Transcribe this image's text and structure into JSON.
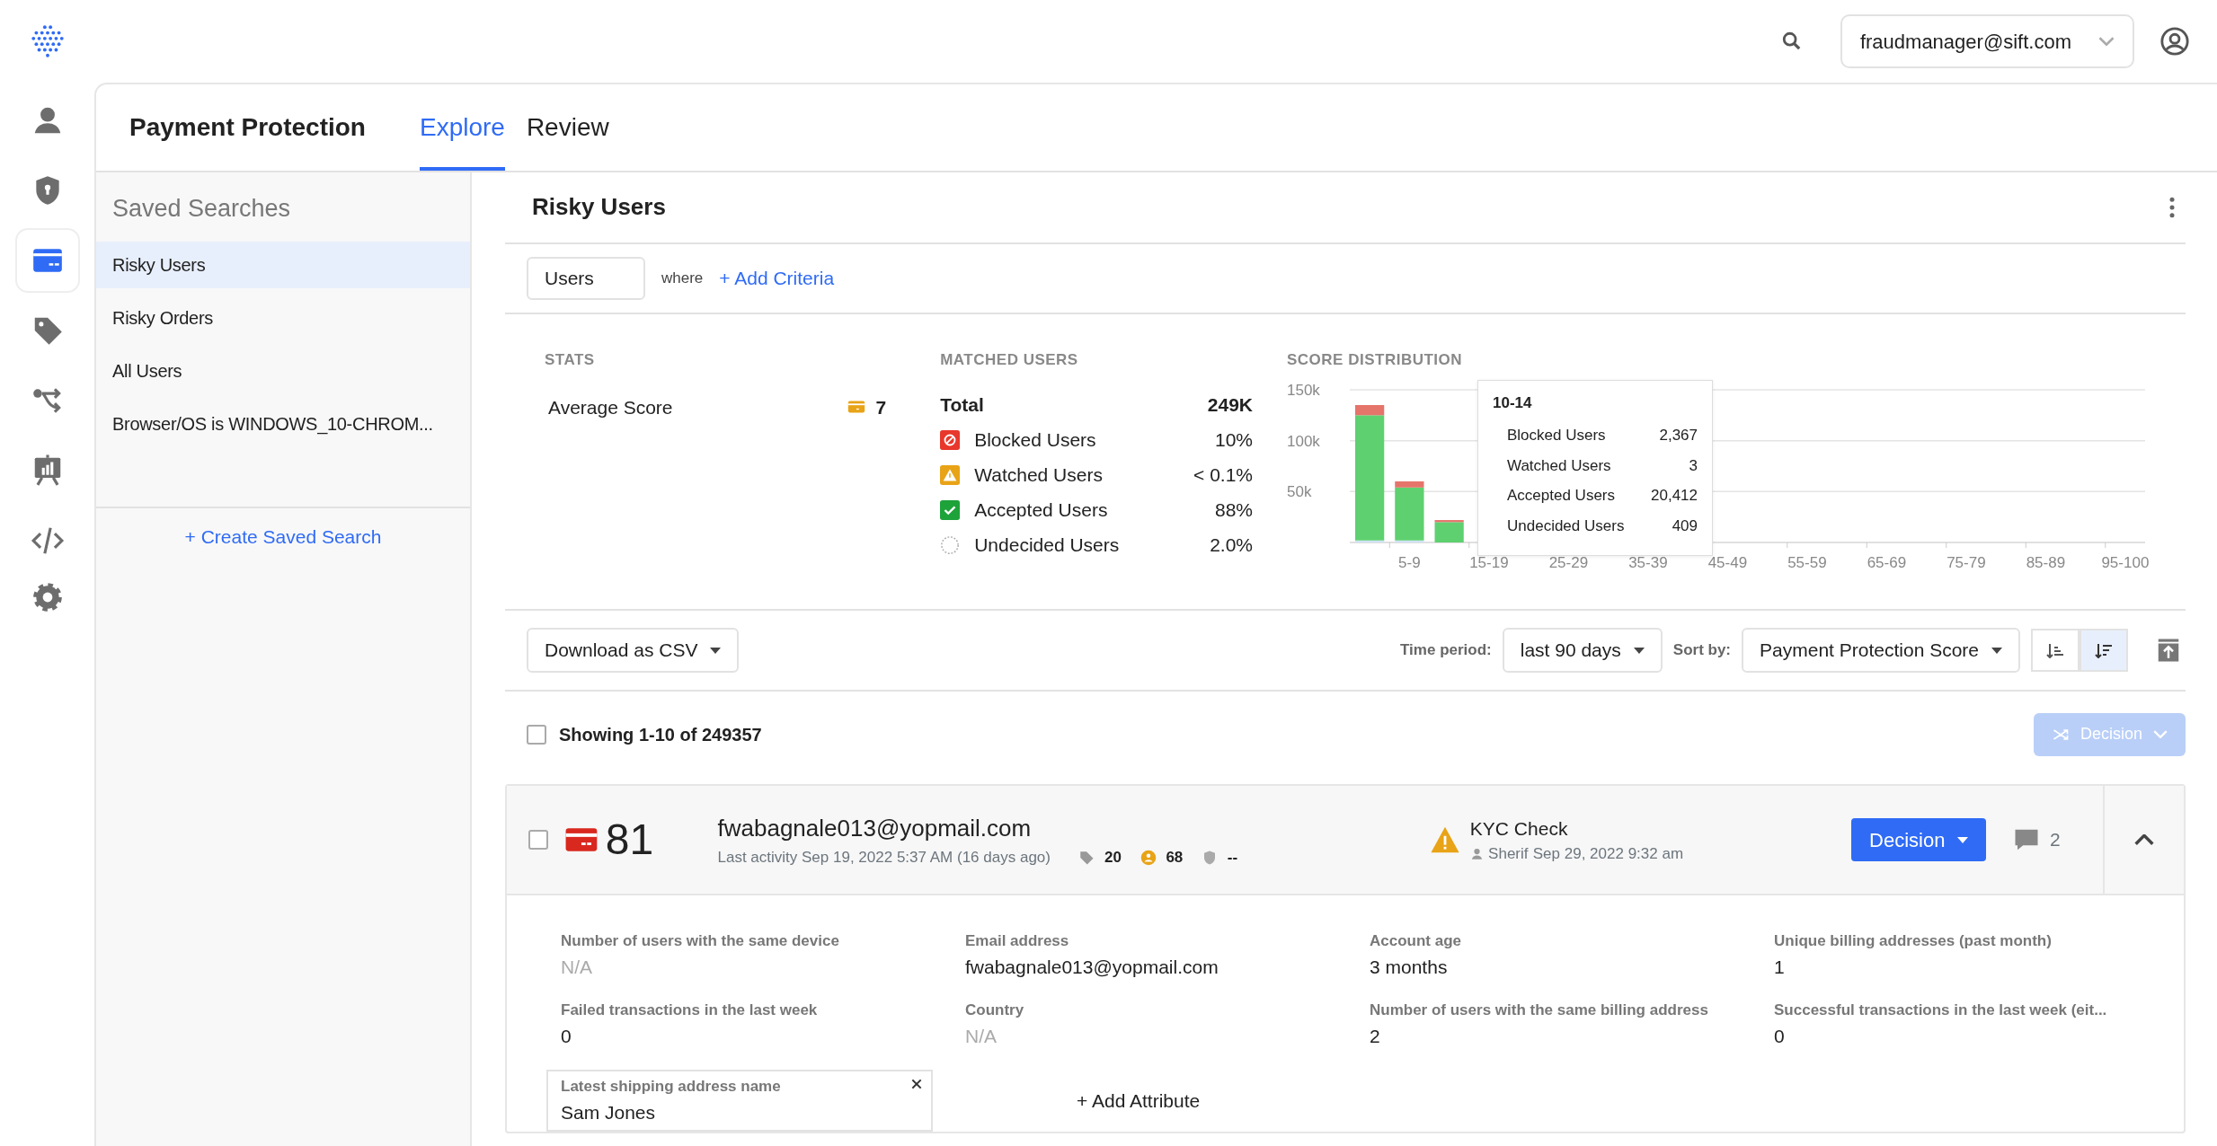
{
  "topbar": {
    "account": "fraudmanager@sift.com"
  },
  "nav_rail": [
    {
      "selected": false
    },
    {
      "selected": false
    },
    {
      "selected": true
    },
    {
      "selected": false
    },
    {
      "selected": false
    },
    {
      "selected": false
    },
    {
      "selected": false
    }
  ],
  "header": {
    "title": "Payment Protection",
    "tabs": [
      {
        "label": "Explore",
        "selected": true
      },
      {
        "label": "Review",
        "selected": false
      }
    ]
  },
  "saved_searches": {
    "title": "Saved Searches",
    "items": [
      {
        "label": "Risky Users",
        "selected": true
      },
      {
        "label": "Risky Orders",
        "selected": false
      },
      {
        "label": "All Users",
        "selected": false
      },
      {
        "label": "Browser/OS is WINDOWS_10-CHROM...",
        "selected": false
      }
    ],
    "create": "+ Create Saved Search"
  },
  "search": {
    "title": "Risky Users",
    "entity": "Users",
    "where": "where",
    "add_criteria": "+ Add Criteria"
  },
  "stats": {
    "heading": "STATS",
    "items": [
      {
        "label": "Average Score",
        "value": "7"
      }
    ]
  },
  "matched": {
    "heading": "MATCHED USERS",
    "total_label": "Total",
    "total": "249K",
    "rows": [
      {
        "kind": "blocked",
        "label": "Blocked Users",
        "value": "10%"
      },
      {
        "kind": "watched",
        "label": "Watched Users",
        "value": "< 0.1%"
      },
      {
        "kind": "accepted",
        "label": "Accepted Users",
        "value": "88%"
      },
      {
        "kind": "undecided",
        "label": "Undecided Users",
        "value": "2.0%"
      }
    ]
  },
  "distribution": {
    "heading": "SCORE DISTRIBUTION",
    "chart_data": {
      "type": "bar",
      "stacked": true,
      "categories": [
        null,
        "5-9",
        null,
        "15-19",
        null,
        "25-29",
        null,
        "35-39",
        null,
        "45-49",
        null,
        "55-59",
        null,
        "65-69",
        null,
        "75-79",
        null,
        "85-89",
        null,
        "95-100"
      ],
      "ylim": [
        0,
        150000
      ],
      "yticks": [
        {
          "value": 50000,
          "label": "50k"
        },
        {
          "value": 100000,
          "label": "100k"
        },
        {
          "value": 150000,
          "label": "150k"
        }
      ],
      "series": [
        {
          "color": "#cfe3f3",
          "values": [
            2000,
            2000,
            0,
            0,
            0,
            0,
            0,
            0,
            0,
            0,
            0,
            0,
            0,
            0,
            0,
            0,
            0,
            0,
            0,
            0
          ]
        },
        {
          "color": "#5ed070",
          "values": [
            123000,
            52000,
            20000,
            0,
            0,
            0,
            0,
            0,
            0,
            0,
            0,
            0,
            0,
            0,
            0,
            0,
            0,
            0,
            0,
            0
          ]
        },
        {
          "color": "#e5746b",
          "values": [
            10000,
            6000,
            2000,
            0,
            0,
            0,
            0,
            0,
            0,
            0,
            0,
            0,
            0,
            0,
            0,
            0,
            0,
            0,
            0,
            0
          ]
        }
      ]
    },
    "tooltip": {
      "title": "10-14",
      "rows": [
        {
          "label": "Blocked Users",
          "value": "2,367"
        },
        {
          "label": "Watched Users",
          "value": "3"
        },
        {
          "label": "Accepted Users",
          "value": "20,412"
        },
        {
          "label": "Undecided Users",
          "value": "409"
        }
      ]
    }
  },
  "toolbar": {
    "download": "Download as CSV",
    "time_label": "Time period:",
    "time": "last 90 days",
    "sort_label": "Sort by:",
    "sort": "Payment Protection Score",
    "sort_order": [
      {
        "selected": false
      },
      {
        "selected": true
      }
    ]
  },
  "results": {
    "showing": "Showing 1-10 of 249357",
    "checked": false,
    "bulk_decision": {
      "label": "Decision",
      "disabled": true
    }
  },
  "users": [
    {
      "checked": false,
      "score": "81",
      "email": "fwabagnale013@yopmail.com",
      "last_activity": "Last activity Sep 19, 2022 5:37 AM (16 days ago)",
      "tags": "20",
      "user_score": "68",
      "shield": "--",
      "workflow": "KYC Check",
      "analyst": "Sherif",
      "workflow_time": "Sep 29, 2022 9:32 am",
      "decision": "Decision",
      "comments": "2",
      "expanded": true,
      "attributes": [
        {
          "label": "Number of users with the same device",
          "value": "N/A",
          "muted": true
        },
        {
          "label": "Email address",
          "value": "fwabagnale013@yopmail.com",
          "muted": false
        },
        {
          "label": "Account age",
          "value": "3 months",
          "muted": false
        },
        {
          "label": "Unique billing addresses (past month)",
          "value": "1",
          "muted": false
        },
        {
          "label": "Failed transactions in the last week",
          "value": "0",
          "muted": false
        },
        {
          "label": "Country",
          "value": "N/A",
          "muted": true
        },
        {
          "label": "Number of users with the same billing address",
          "value": "2",
          "muted": false
        },
        {
          "label": "Successful transactions in the last week (eit...",
          "value": "0",
          "muted": false
        }
      ],
      "pinned_attribute": {
        "label": "Latest shipping address name",
        "value": "Sam Jones"
      },
      "add_attribute": "+ Add Attribute"
    }
  ]
}
